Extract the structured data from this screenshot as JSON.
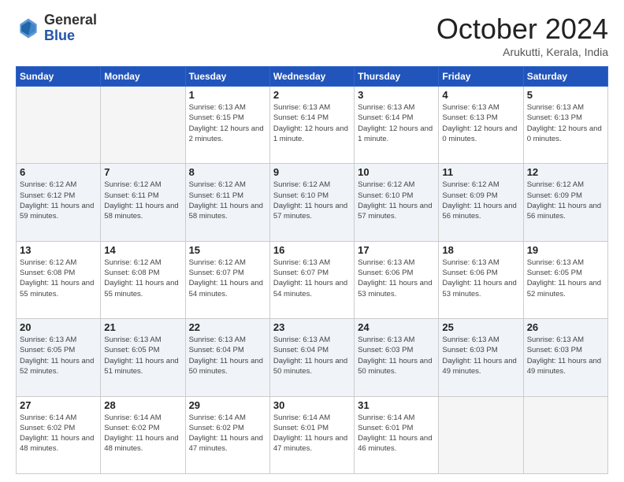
{
  "header": {
    "logo": {
      "line1": "General",
      "line2": "Blue"
    },
    "title": "October 2024",
    "location": "Arukutti, Kerala, India"
  },
  "weekdays": [
    "Sunday",
    "Monday",
    "Tuesday",
    "Wednesday",
    "Thursday",
    "Friday",
    "Saturday"
  ],
  "weeks": [
    [
      {
        "day": "",
        "sunrise": "",
        "sunset": "",
        "daylight": "",
        "empty": true
      },
      {
        "day": "",
        "sunrise": "",
        "sunset": "",
        "daylight": "",
        "empty": true
      },
      {
        "day": "1",
        "sunrise": "Sunrise: 6:13 AM",
        "sunset": "Sunset: 6:15 PM",
        "daylight": "Daylight: 12 hours and 2 minutes."
      },
      {
        "day": "2",
        "sunrise": "Sunrise: 6:13 AM",
        "sunset": "Sunset: 6:14 PM",
        "daylight": "Daylight: 12 hours and 1 minute."
      },
      {
        "day": "3",
        "sunrise": "Sunrise: 6:13 AM",
        "sunset": "Sunset: 6:14 PM",
        "daylight": "Daylight: 12 hours and 1 minute."
      },
      {
        "day": "4",
        "sunrise": "Sunrise: 6:13 AM",
        "sunset": "Sunset: 6:13 PM",
        "daylight": "Daylight: 12 hours and 0 minutes."
      },
      {
        "day": "5",
        "sunrise": "Sunrise: 6:13 AM",
        "sunset": "Sunset: 6:13 PM",
        "daylight": "Daylight: 12 hours and 0 minutes."
      }
    ],
    [
      {
        "day": "6",
        "sunrise": "Sunrise: 6:12 AM",
        "sunset": "Sunset: 6:12 PM",
        "daylight": "Daylight: 11 hours and 59 minutes."
      },
      {
        "day": "7",
        "sunrise": "Sunrise: 6:12 AM",
        "sunset": "Sunset: 6:11 PM",
        "daylight": "Daylight: 11 hours and 58 minutes."
      },
      {
        "day": "8",
        "sunrise": "Sunrise: 6:12 AM",
        "sunset": "Sunset: 6:11 PM",
        "daylight": "Daylight: 11 hours and 58 minutes."
      },
      {
        "day": "9",
        "sunrise": "Sunrise: 6:12 AM",
        "sunset": "Sunset: 6:10 PM",
        "daylight": "Daylight: 11 hours and 57 minutes."
      },
      {
        "day": "10",
        "sunrise": "Sunrise: 6:12 AM",
        "sunset": "Sunset: 6:10 PM",
        "daylight": "Daylight: 11 hours and 57 minutes."
      },
      {
        "day": "11",
        "sunrise": "Sunrise: 6:12 AM",
        "sunset": "Sunset: 6:09 PM",
        "daylight": "Daylight: 11 hours and 56 minutes."
      },
      {
        "day": "12",
        "sunrise": "Sunrise: 6:12 AM",
        "sunset": "Sunset: 6:09 PM",
        "daylight": "Daylight: 11 hours and 56 minutes."
      }
    ],
    [
      {
        "day": "13",
        "sunrise": "Sunrise: 6:12 AM",
        "sunset": "Sunset: 6:08 PM",
        "daylight": "Daylight: 11 hours and 55 minutes."
      },
      {
        "day": "14",
        "sunrise": "Sunrise: 6:12 AM",
        "sunset": "Sunset: 6:08 PM",
        "daylight": "Daylight: 11 hours and 55 minutes."
      },
      {
        "day": "15",
        "sunrise": "Sunrise: 6:12 AM",
        "sunset": "Sunset: 6:07 PM",
        "daylight": "Daylight: 11 hours and 54 minutes."
      },
      {
        "day": "16",
        "sunrise": "Sunrise: 6:13 AM",
        "sunset": "Sunset: 6:07 PM",
        "daylight": "Daylight: 11 hours and 54 minutes."
      },
      {
        "day": "17",
        "sunrise": "Sunrise: 6:13 AM",
        "sunset": "Sunset: 6:06 PM",
        "daylight": "Daylight: 11 hours and 53 minutes."
      },
      {
        "day": "18",
        "sunrise": "Sunrise: 6:13 AM",
        "sunset": "Sunset: 6:06 PM",
        "daylight": "Daylight: 11 hours and 53 minutes."
      },
      {
        "day": "19",
        "sunrise": "Sunrise: 6:13 AM",
        "sunset": "Sunset: 6:05 PM",
        "daylight": "Daylight: 11 hours and 52 minutes."
      }
    ],
    [
      {
        "day": "20",
        "sunrise": "Sunrise: 6:13 AM",
        "sunset": "Sunset: 6:05 PM",
        "daylight": "Daylight: 11 hours and 52 minutes."
      },
      {
        "day": "21",
        "sunrise": "Sunrise: 6:13 AM",
        "sunset": "Sunset: 6:05 PM",
        "daylight": "Daylight: 11 hours and 51 minutes."
      },
      {
        "day": "22",
        "sunrise": "Sunrise: 6:13 AM",
        "sunset": "Sunset: 6:04 PM",
        "daylight": "Daylight: 11 hours and 50 minutes."
      },
      {
        "day": "23",
        "sunrise": "Sunrise: 6:13 AM",
        "sunset": "Sunset: 6:04 PM",
        "daylight": "Daylight: 11 hours and 50 minutes."
      },
      {
        "day": "24",
        "sunrise": "Sunrise: 6:13 AM",
        "sunset": "Sunset: 6:03 PM",
        "daylight": "Daylight: 11 hours and 50 minutes."
      },
      {
        "day": "25",
        "sunrise": "Sunrise: 6:13 AM",
        "sunset": "Sunset: 6:03 PM",
        "daylight": "Daylight: 11 hours and 49 minutes."
      },
      {
        "day": "26",
        "sunrise": "Sunrise: 6:13 AM",
        "sunset": "Sunset: 6:03 PM",
        "daylight": "Daylight: 11 hours and 49 minutes."
      }
    ],
    [
      {
        "day": "27",
        "sunrise": "Sunrise: 6:14 AM",
        "sunset": "Sunset: 6:02 PM",
        "daylight": "Daylight: 11 hours and 48 minutes."
      },
      {
        "day": "28",
        "sunrise": "Sunrise: 6:14 AM",
        "sunset": "Sunset: 6:02 PM",
        "daylight": "Daylight: 11 hours and 48 minutes."
      },
      {
        "day": "29",
        "sunrise": "Sunrise: 6:14 AM",
        "sunset": "Sunset: 6:02 PM",
        "daylight": "Daylight: 11 hours and 47 minutes."
      },
      {
        "day": "30",
        "sunrise": "Sunrise: 6:14 AM",
        "sunset": "Sunset: 6:01 PM",
        "daylight": "Daylight: 11 hours and 47 minutes."
      },
      {
        "day": "31",
        "sunrise": "Sunrise: 6:14 AM",
        "sunset": "Sunset: 6:01 PM",
        "daylight": "Daylight: 11 hours and 46 minutes."
      },
      {
        "day": "",
        "sunrise": "",
        "sunset": "",
        "daylight": "",
        "empty": true
      },
      {
        "day": "",
        "sunrise": "",
        "sunset": "",
        "daylight": "",
        "empty": true
      }
    ]
  ]
}
